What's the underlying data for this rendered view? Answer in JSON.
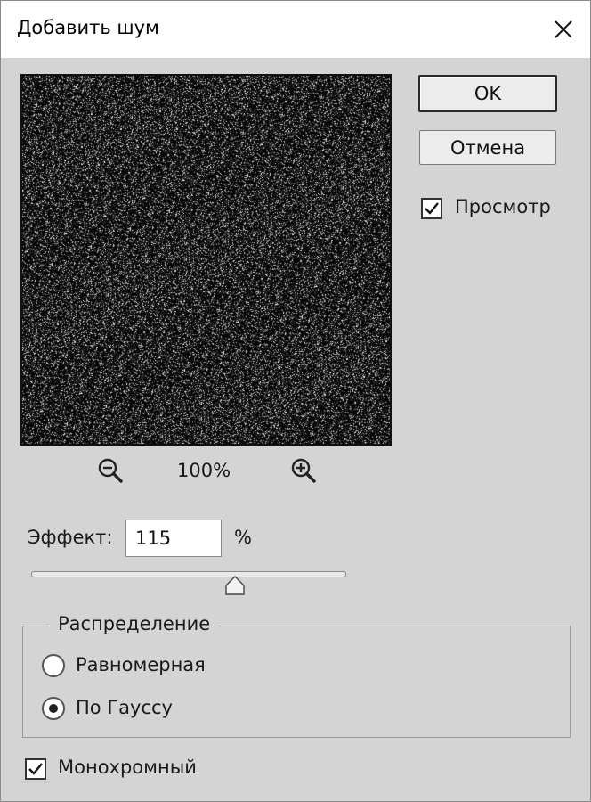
{
  "window": {
    "title": "Добавить шум"
  },
  "buttons": {
    "ok": "OK",
    "cancel": "Отмена"
  },
  "preview_checkbox": {
    "label": "Просмотр",
    "checked": true
  },
  "zoom": {
    "level": "100%"
  },
  "effect": {
    "label": "Эффект:",
    "value": "115",
    "unit": "%",
    "slider_fraction": 0.64
  },
  "distribution": {
    "title": "Распределение",
    "options": [
      {
        "label": "Равномерная",
        "selected": false
      },
      {
        "label": "По Гауссу",
        "selected": true
      }
    ]
  },
  "monochrome": {
    "label": "Монохромный",
    "checked": true
  },
  "icons": {
    "close": "close-icon",
    "zoom_out": "zoom-out-icon",
    "zoom_in": "zoom-in-icon",
    "check": "check-icon",
    "slider_thumb": "slider-thumb-icon"
  },
  "colors": {
    "window_bg": "#d4d4d4",
    "titlebar_bg": "#ffffff",
    "preview_bg": "#050505"
  }
}
